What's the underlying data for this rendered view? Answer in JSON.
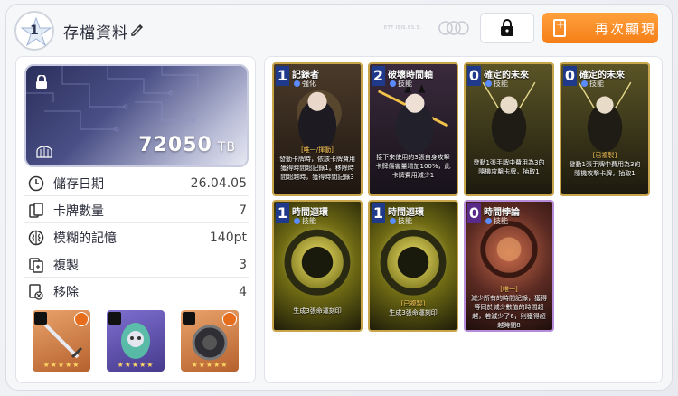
{
  "header": {
    "level": "1",
    "title": "存檔資料",
    "watermark": "ETF ISIS.BS.S.",
    "replay_label": "再次顯現"
  },
  "data_card": {
    "value": "72050",
    "unit": "TB"
  },
  "stats": [
    {
      "label": "儲存日期",
      "value": "26.04.05",
      "icon": "clock-icon"
    },
    {
      "label": "卡牌數量",
      "value": "7",
      "icon": "cards-icon"
    },
    {
      "label": "模糊的記憶",
      "value": "140pt",
      "icon": "brain-icon"
    },
    {
      "label": "複製",
      "value": "3",
      "icon": "copy-icon"
    },
    {
      "label": "移除",
      "value": "4",
      "icon": "remove-icon"
    }
  ],
  "relics": [
    {
      "name": "sword-relic",
      "stars": "★★★★★",
      "color": "#d8834a"
    },
    {
      "name": "spirit-relic",
      "stars": "★★★★★",
      "color": "#6b5bb8"
    },
    {
      "name": "gear-relic",
      "stars": "★★★★★",
      "color": "#d8834a"
    }
  ],
  "cards": [
    {
      "cost": "1",
      "name": "記錄者",
      "type": "強化",
      "tag": "[唯一/揮動]",
      "desc": "發動卡牌時，依該卡牌費用獲得時間超記錄1。移除時間超越時，獲得時間記錄3",
      "bg": "#3a2a20"
    },
    {
      "cost": "2",
      "name": "破壞時間軸",
      "type": "技能",
      "tag": "",
      "desc": "接下來使用的3張自身攻擊卡牌傷害量增加100%，此卡牌費用減少1",
      "bg": "#2a1e30"
    },
    {
      "cost": "0",
      "name": "確定的未來",
      "type": "技能",
      "tag": "",
      "desc": "發動1張手牌中費用為3的隨機攻擊卡牌，抽取1",
      "bg": "#2c2a1a"
    },
    {
      "cost": "0",
      "name": "確定的未來",
      "type": "技能",
      "tag": "[已複製]",
      "desc": "發動1張手牌中費用為3的隨機攻擊卡牌，抽取1",
      "bg": "#2c2a1a"
    },
    {
      "cost": "1",
      "name": "時間迴環",
      "type": "技能",
      "tag": "",
      "desc": "生成3張命運刻印",
      "bg": "#3a3210"
    },
    {
      "cost": "1",
      "name": "時間迴環",
      "type": "技能",
      "tag": "[已複製]",
      "desc": "生成3張命運刻印",
      "bg": "#3a3210"
    },
    {
      "cost": "0",
      "name": "時間悖論",
      "type": "技能",
      "tag": "[唯一]",
      "desc": "減少所有的時間記錄，獲得等同於減少數值的時間超越，若減少了6，則獲得超越時間8",
      "bg": "#3a1e22"
    }
  ]
}
